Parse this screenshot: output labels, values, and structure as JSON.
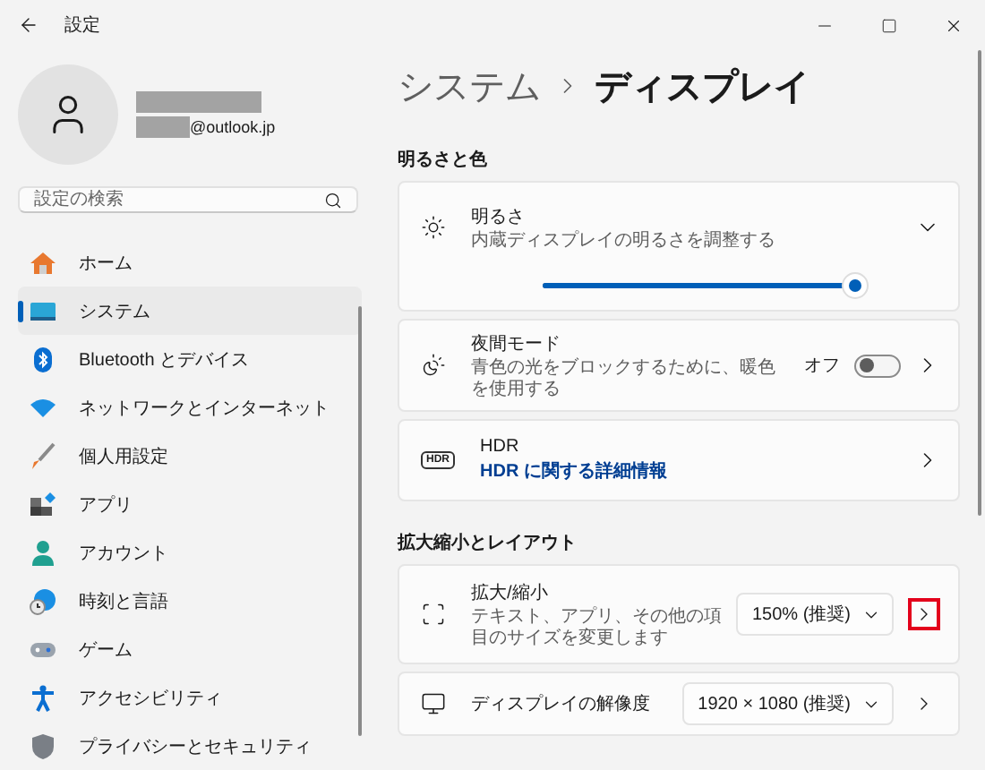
{
  "window": {
    "title": "設定"
  },
  "account": {
    "email": "@outlook.jp"
  },
  "search": {
    "placeholder": "設定の検索"
  },
  "sidebar": {
    "items": [
      {
        "kind": "home",
        "label": "ホーム",
        "selected": false
      },
      {
        "kind": "system",
        "label": "システム",
        "selected": true
      },
      {
        "kind": "bluetooth",
        "label": "Bluetooth とデバイス",
        "selected": false
      },
      {
        "kind": "network",
        "label": "ネットワークとインターネット",
        "selected": false
      },
      {
        "kind": "brush",
        "label": "個人用設定",
        "selected": false
      },
      {
        "kind": "apps",
        "label": "アプリ",
        "selected": false
      },
      {
        "kind": "account",
        "label": "アカウント",
        "selected": false
      },
      {
        "kind": "time",
        "label": "時刻と言語",
        "selected": false
      },
      {
        "kind": "game",
        "label": "ゲーム",
        "selected": false
      },
      {
        "kind": "accessibility",
        "label": "アクセシビリティ",
        "selected": false
      },
      {
        "kind": "shield",
        "label": "プライバシーとセキュリティ",
        "selected": false
      }
    ]
  },
  "breadcrumb": {
    "parent": "システム",
    "current": "ディスプレイ"
  },
  "sections": [
    {
      "title": "明るさと色",
      "cards": [
        {
          "kind": "slider",
          "title": "明るさ",
          "subtitle": "内蔵ディスプレイの明るさを調整する",
          "level": 1,
          "expanded": false
        },
        {
          "kind": "toggle",
          "title": "夜間モード",
          "subtitle": "青色の光をブロックするために、暖色を使用する",
          "state_label": "オフ",
          "on": false
        },
        {
          "kind": "link",
          "icon_text": "HDR",
          "title": "HDR",
          "link": "HDR に関する詳細情報"
        }
      ]
    },
    {
      "title": "拡大縮小とレイアウト",
      "cards": [
        {
          "kind": "dropdown",
          "title": "拡大/縮小",
          "subtitle": "テキスト、アプリ、その他の項目のサイズを変更します",
          "value": "150% (推奨)",
          "highlighted": true
        },
        {
          "kind": "dropdown",
          "title": "ディスプレイの解像度",
          "value": "1920 × 1080 (推奨)",
          "highlighted": false
        }
      ]
    }
  ]
}
